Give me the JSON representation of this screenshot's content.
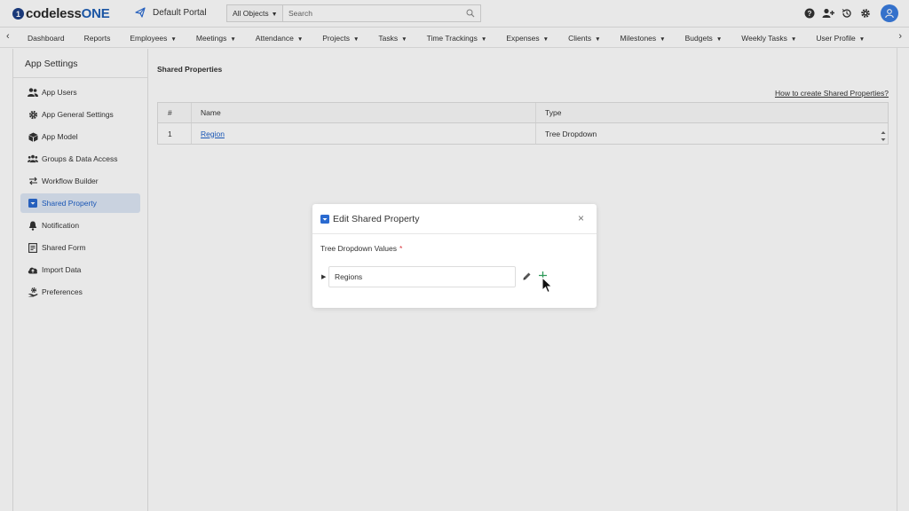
{
  "app": {
    "logo_mark": "1",
    "logo_text_main": "codeless",
    "logo_text_accent": "ONE",
    "portal_name": "Default Portal"
  },
  "search": {
    "scope": "All Objects",
    "placeholder": "Search"
  },
  "top_icons": [
    "help-icon",
    "add-user-icon",
    "history-icon",
    "settings-icon",
    "user-avatar"
  ],
  "nav": {
    "items": [
      {
        "label": "Dashboard",
        "dropdown": false
      },
      {
        "label": "Reports",
        "dropdown": false
      },
      {
        "label": "Employees",
        "dropdown": true
      },
      {
        "label": "Meetings",
        "dropdown": true
      },
      {
        "label": "Attendance",
        "dropdown": true
      },
      {
        "label": "Projects",
        "dropdown": true
      },
      {
        "label": "Tasks",
        "dropdown": true
      },
      {
        "label": "Time Trackings",
        "dropdown": true
      },
      {
        "label": "Expenses",
        "dropdown": true
      },
      {
        "label": "Clients",
        "dropdown": true
      },
      {
        "label": "Milestones",
        "dropdown": true
      },
      {
        "label": "Budgets",
        "dropdown": true
      },
      {
        "label": "Weekly Tasks",
        "dropdown": true
      },
      {
        "label": "User Profile",
        "dropdown": true
      }
    ]
  },
  "sidebar": {
    "title": "App Settings",
    "items": [
      {
        "label": "App Users",
        "icon": "users-icon",
        "active": false
      },
      {
        "label": "App General Settings",
        "icon": "gear-icon",
        "active": false
      },
      {
        "label": "App Model",
        "icon": "cube-icon",
        "active": false
      },
      {
        "label": "Groups & Data Access",
        "icon": "group-icon",
        "active": false
      },
      {
        "label": "Workflow Builder",
        "icon": "swap-arrows-icon",
        "active": false
      },
      {
        "label": "Shared Property",
        "icon": "dropdown-box-icon",
        "active": true
      },
      {
        "label": "Notification",
        "icon": "bell-icon",
        "active": false
      },
      {
        "label": "Shared Form",
        "icon": "form-icon",
        "active": false
      },
      {
        "label": "Import Data",
        "icon": "cloud-upload-icon",
        "active": false
      },
      {
        "label": "Preferences",
        "icon": "hand-gear-icon",
        "active": false
      }
    ]
  },
  "main": {
    "title": "Shared Properties",
    "help_link": "How to create Shared Properties?",
    "table": {
      "columns": [
        "#",
        "Name",
        "Type"
      ],
      "rows": [
        {
          "num": "1",
          "name": "Region",
          "type": "Tree Dropdown"
        }
      ]
    }
  },
  "modal": {
    "title": "Edit Shared Property",
    "close": "×",
    "field_label": "Tree Dropdown Values",
    "required_mark": "*",
    "tree_value": "Regions"
  },
  "colors": {
    "brand_blue": "#1f5fb5",
    "link_blue": "#1c5fc7",
    "active_bg": "#dde7f6",
    "add_green": "#2f9a5a",
    "required_red": "#d9363e"
  }
}
